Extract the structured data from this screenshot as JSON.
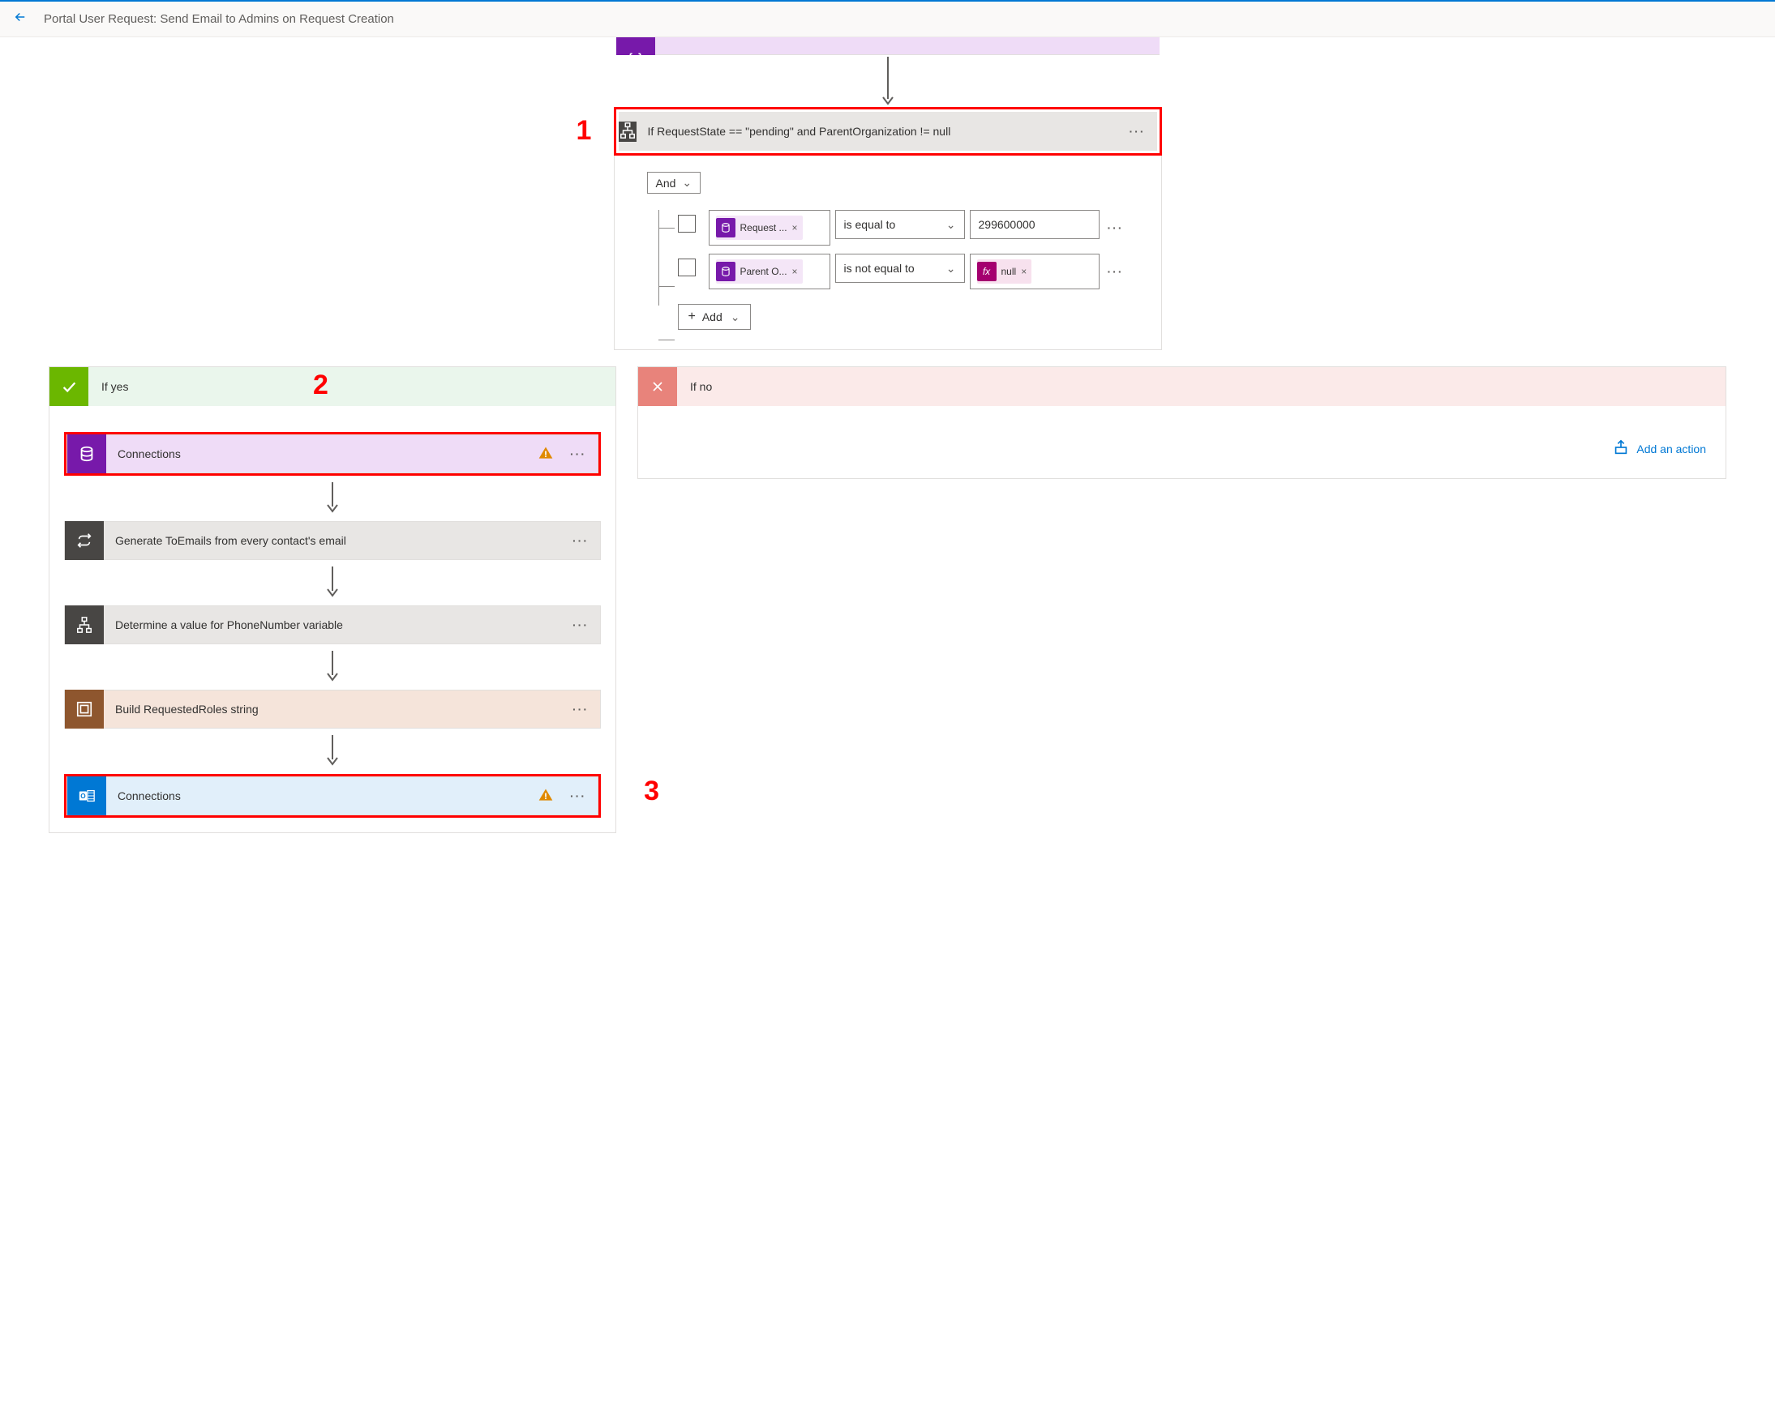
{
  "header": {
    "title": "Portal User Request: Send Email to Admins on Request Creation"
  },
  "condition": {
    "title": "If RequestState == \"pending\" and ParentOrganization != null",
    "logic": "And",
    "add_label": "Add",
    "rows": [
      {
        "token": "Request ...",
        "op": "is equal to",
        "value": "299600000",
        "token_type": "purple"
      },
      {
        "token": "Parent O...",
        "op": "is not equal to",
        "value_token": "null",
        "token_type": "purple",
        "value_token_type": "pink"
      }
    ]
  },
  "yes": {
    "label": "If yes",
    "actions": [
      {
        "label": "Connections",
        "icon": "dataverse",
        "warn": true
      },
      {
        "label": "Generate ToEmails from every contact's email",
        "icon": "loop"
      },
      {
        "label": "Determine a value for PhoneNumber variable",
        "icon": "condition"
      },
      {
        "label": "Build RequestedRoles string",
        "icon": "container"
      },
      {
        "label": "Connections",
        "icon": "outlook",
        "warn": true
      }
    ]
  },
  "no": {
    "label": "If no",
    "add_action": "Add an action"
  },
  "annotations": {
    "n1": "1",
    "n2": "2",
    "n3": "3"
  }
}
